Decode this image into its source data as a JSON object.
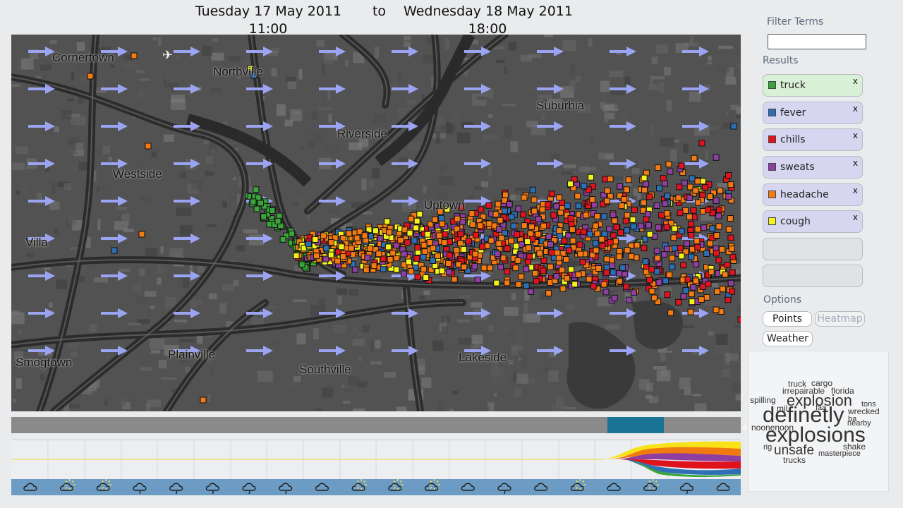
{
  "header": {
    "start_date": "Tuesday 17 May 2011",
    "start_time": "11:00",
    "separator": "to",
    "end_date": "Wednesday 18 May 2011",
    "end_time": "18:00"
  },
  "map": {
    "places": [
      "Cornertown",
      "Northville",
      "Riverside",
      "Suburbia",
      "Westside",
      "Villa",
      "Uptown",
      "Smogtown",
      "Plainville",
      "Southville",
      "Lakeside"
    ]
  },
  "timeline": {
    "slider_value": "4",
    "weather_icons": [
      "cloud-icon",
      "partly-sunny-icon",
      "partly-sunny-icon",
      "rain-icon",
      "rain-icon",
      "rain-icon",
      "rain-icon",
      "rain-icon",
      "cloud-icon",
      "partly-sunny-icon",
      "partly-sunny-icon",
      "partly-sunny-icon",
      "cloud-icon",
      "rain-icon",
      "cloud-icon",
      "partly-sunny-icon",
      "cloud-icon",
      "partly-sunny-icon",
      "rain-icon",
      "cloud-icon"
    ]
  },
  "sidebar": {
    "filter_label": "Filter Terms",
    "filter_value": "",
    "results_label": "Results",
    "results": [
      {
        "term": "truck",
        "color": "#3aa53a",
        "close": "x"
      },
      {
        "term": "fever",
        "color": "#2d6fb5",
        "close": "x"
      },
      {
        "term": "chills",
        "color": "#e0141e",
        "close": "x"
      },
      {
        "term": "sweats",
        "color": "#8e3fa0",
        "close": "x"
      },
      {
        "term": "headache",
        "color": "#f47a12",
        "close": "x"
      },
      {
        "term": "cough",
        "color": "#f2f21c",
        "close": "x"
      }
    ],
    "options_label": "Options",
    "options": {
      "points": "Points",
      "heatmap": "Heatmap",
      "weather": "Weather"
    }
  },
  "word_cloud": {
    "words": [
      "truck",
      "cargo",
      "irrepairable",
      "florida",
      "spilling",
      "explosion",
      "tons",
      "mil",
      "faa",
      "definetly",
      "wrecked",
      "ba",
      "noonenoon",
      "nearby",
      "explosions",
      "rig",
      "unsafe",
      "shake",
      "masterpiece",
      "trucks"
    ]
  }
}
